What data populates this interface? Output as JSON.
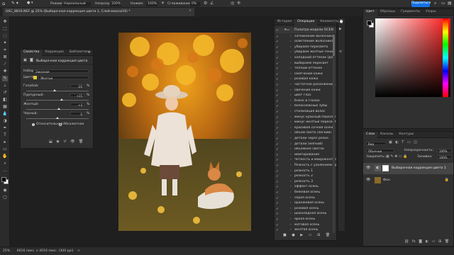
{
  "options_bar": {
    "mode_label": "Режим:",
    "mode_value": "Нормальный",
    "opacity_label": "Непрозр.:",
    "opacity_value": "100%",
    "flow_label": "Нажим:",
    "flow_value": "100%",
    "smoothing_label": "Сглаживание:",
    "smoothing_value": "0%",
    "share_button": "Поделиться"
  },
  "document_tab": {
    "title": "DSC_8816.NEF @ 25% (Выборочная коррекция цвета 1, Слой-маска/16) *",
    "close": "×"
  },
  "properties_panel": {
    "tabs": [
      "Свойства",
      "Коррекция",
      "Библиотеки"
    ],
    "header_title": "Выборочная коррекция цвета",
    "preset_label": "Набор:",
    "preset_value": "Заказная",
    "colors_label": "Цвета:",
    "colors_value": "Желтые",
    "colors_swatch": "#e8c930",
    "sliders": [
      {
        "label": "Голубой:",
        "value": "-20",
        "unit": "%",
        "pos": 0.45
      },
      {
        "label": "Пурпурный:",
        "value": "+15",
        "unit": "%",
        "pos": 0.57
      },
      {
        "label": "Желтый:",
        "value": "+4",
        "unit": "%",
        "pos": 0.52
      },
      {
        "label": "Черный:",
        "value": "0",
        "unit": "%",
        "pos": 0.5
      }
    ],
    "method_relative": "Относительная",
    "method_absolute": "Абсолютная"
  },
  "actions_panel": {
    "tabs": [
      "История",
      "Операции",
      "Комментар"
    ],
    "group_name": "Палитра модели OCEN",
    "items": [
      "затемнение волосника",
      "осветление волосника",
      "убираем пересвета",
      "убираем желтые тени",
      "холодный оттенок (для ...",
      "выбираем пересвет",
      "теплый оттенок",
      "смягчение кожи",
      "розовая кожа",
      "частотное разложение ...",
      "свечение кожи",
      "цвет глаз",
      "блеск в глазах",
      "белоснежные зубы",
      "стилизация волос",
      "минус красный пересвет",
      "минус желтый пересвет",
      "красивая сочная осень",
      "объем света (легкий)",
      "детали через резко",
      "детали (мягкий)",
      "объемное светло",
      "имитирование",
      "Четкость и микроконтра...",
      "Резкость с усилением цвета",
      "резкость 1",
      "резкость 2",
      "резкость 3",
      "эффект осень",
      "бежевая осень",
      "серая осень",
      "оранжевая осень",
      "розовая осень",
      "шоколадная осень",
      "яркая осень",
      "матовая осень",
      "желтая осень"
    ]
  },
  "color_panel": {
    "tabs": [
      "Цвет",
      "Образцы",
      "Градиенты",
      "Узоры"
    ],
    "foreground": "#000000",
    "background": "#ffffff"
  },
  "layers_panel": {
    "tabs": [
      "Слои",
      "Каналы",
      "Контуры"
    ],
    "filter_label": "Вид",
    "blend_mode": "Обычные",
    "opacity_label": "Непрозрачность:",
    "opacity_value": "100%",
    "fill_label": "Заливка:",
    "fill_value": "100%",
    "lock_label": "Закрепить:",
    "layers": [
      {
        "name": "Выборочная коррекция цвета 1",
        "selected": true
      },
      {
        "name": "Фон",
        "selected": false
      }
    ]
  },
  "status_bar": {
    "zoom": "25%",
    "doc_info": "6016 пикс. x 4016 пикс. (300 ppi)",
    "arrow": ">"
  }
}
